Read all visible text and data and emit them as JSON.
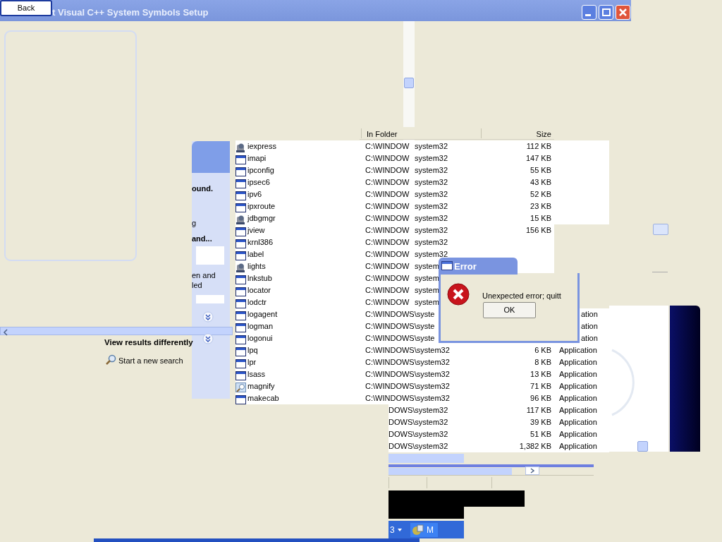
{
  "title_bar": {
    "title": "t Visual C++ System Symbols Setup",
    "back": "Back"
  },
  "task_pane": {
    "fragments": [
      {
        "kind": "heading",
        "text": "ound."
      },
      {
        "kind": "text",
        "text": "g"
      },
      {
        "kind": "heading",
        "text": "and..."
      },
      {
        "kind": "text",
        "text": "en and"
      },
      {
        "kind": "text",
        "text": "led"
      }
    ],
    "view_results": "View results differently",
    "new_search": "Start a new search"
  },
  "columns": [
    "In Folder",
    "Size"
  ],
  "rows": [
    {
      "kind": "program",
      "name": "iexpress",
      "folder": [
        "C:\\WINDOW",
        "system32"
      ],
      "size": "112 KB"
    },
    {
      "kind": "window",
      "name": "imapi",
      "folder": [
        "C:\\WINDOW",
        "system32"
      ],
      "size": "147 KB"
    },
    {
      "kind": "window",
      "name": "ipconfig",
      "folder": [
        "C:\\WINDOW",
        "system32"
      ],
      "size": "55 KB"
    },
    {
      "kind": "window",
      "name": "ipsec6",
      "folder": [
        "C:\\WINDOW",
        "system32"
      ],
      "size": "43 KB"
    },
    {
      "kind": "window",
      "name": "ipv6",
      "folder": [
        "C:\\WINDOW",
        "system32"
      ],
      "size": "52 KB"
    },
    {
      "kind": "window",
      "name": "ipxroute",
      "folder": [
        "C:\\WINDOW",
        "system32"
      ],
      "size": "23 KB"
    },
    {
      "kind": "program",
      "name": "jdbgmgr",
      "folder": [
        "C:\\WINDOW",
        "system32"
      ],
      "size": "15 KB"
    },
    {
      "kind": "window",
      "name": "jview",
      "folder": [
        "C:\\WINDOW",
        "system32"
      ],
      "size": "156 KB"
    },
    {
      "kind": "window",
      "name": "krnl386",
      "folder": [
        "C:\\WINDOW",
        "system32"
      ]
    },
    {
      "kind": "window",
      "name": "label",
      "folder": [
        "C:\\WINDOW",
        "system32"
      ]
    },
    {
      "kind": "program",
      "name": "lights",
      "folder": [
        "C:\\WINDOW",
        "system"
      ]
    },
    {
      "kind": "window",
      "name": "lnkstub",
      "folder": [
        "C:\\WINDOW",
        "system"
      ]
    },
    {
      "kind": "window",
      "name": "locator",
      "folder": [
        "C:\\WINDOW",
        "system"
      ]
    },
    {
      "kind": "window",
      "name": "lodctr",
      "folder": [
        "C:\\WINDOW",
        "system"
      ]
    },
    {
      "kind": "window",
      "name": "logagent",
      "folder": [
        "C:\\WINDOWS\\syste"
      ],
      "type": "ation"
    },
    {
      "kind": "window",
      "name": "logman",
      "folder": [
        "C:\\WINDOWS\\syste"
      ],
      "type": "ation"
    },
    {
      "kind": "window",
      "name": "logonui",
      "folder": [
        "C:\\WINDOWS\\syste"
      ],
      "type": "ation"
    },
    {
      "kind": "window",
      "name": "lpq",
      "folder": [
        "C:\\WINDOWS\\system32"
      ],
      "size": "6 KB",
      "type": "Application"
    },
    {
      "kind": "window",
      "name": "lpr",
      "folder": [
        "C:\\WINDOWS\\system32"
      ],
      "size": "8 KB",
      "type": "Application"
    },
    {
      "kind": "window",
      "name": "lsass",
      "folder": [
        "C:\\WINDOWS\\system32"
      ],
      "size": "13 KB",
      "type": "Application"
    },
    {
      "kind": "magnifier",
      "name": "magnify",
      "folder": [
        "C:\\WINDOWS\\system32"
      ],
      "size": "71 KB",
      "type": "Application"
    },
    {
      "kind": "window",
      "name": "makecab",
      "folder": [
        "C:\\WINDOWS\\system32"
      ],
      "size": "96 KB",
      "type": "Application"
    },
    {
      "kind": "cut",
      "folder": [
        "DOWS\\system32"
      ],
      "size": "117 KB",
      "type": "Application"
    },
    {
      "kind": "cut",
      "folder": [
        "DOWS\\system32"
      ],
      "size": "39 KB",
      "type": "Application"
    },
    {
      "kind": "cut",
      "folder": [
        "DOWS\\system32"
      ],
      "size": "51 KB",
      "type": "Application"
    },
    {
      "kind": "cut",
      "folder": [
        "DOWS\\system32"
      ],
      "size": "1,382 KB",
      "type": "Application"
    }
  ],
  "dialog": {
    "title": "Error",
    "message": "Unexpected error; quitt",
    "button": "OK"
  },
  "taskbar": [
    {
      "kind": "menu",
      "label": "3"
    },
    {
      "kind": "app",
      "label": "M"
    }
  ]
}
